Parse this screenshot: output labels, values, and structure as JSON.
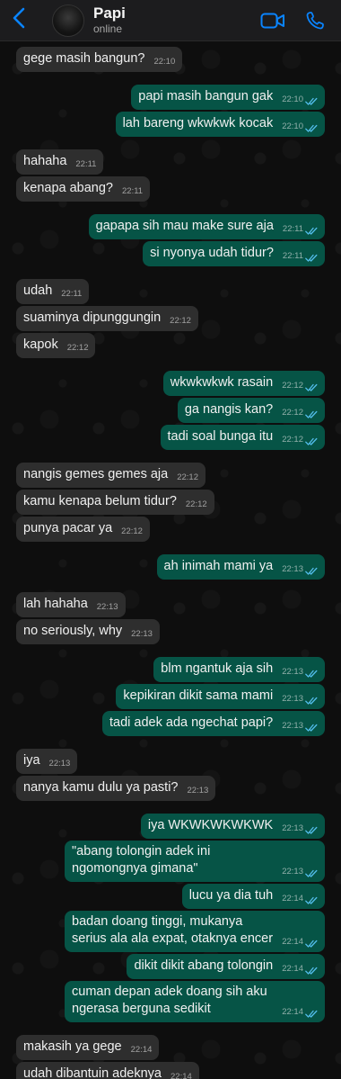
{
  "contact": {
    "name": "Papi",
    "status": "online"
  },
  "icons": {
    "back": "chevron-left-icon",
    "video": "video-camera-icon",
    "call": "phone-icon",
    "read": "double-check-icon"
  },
  "colors": {
    "incoming_bubble": "#2e2e2e",
    "outgoing_bubble": "#065446",
    "read_ticks": "#53bdeb",
    "accent": "#0a84ff"
  },
  "messages": [
    {
      "dir": "in",
      "text": "gege masih bangun?",
      "time": "22:10"
    },
    {
      "dir": "out",
      "text": "papi masih bangun gak",
      "time": "22:10"
    },
    {
      "dir": "out",
      "text": "lah bareng wkwkwk kocak",
      "time": "22:10"
    },
    {
      "dir": "in",
      "text": "hahaha",
      "time": "22:11"
    },
    {
      "dir": "in",
      "text": "kenapa abang?",
      "time": "22:11"
    },
    {
      "dir": "out",
      "text": "gapapa sih mau make sure aja",
      "time": "22:11"
    },
    {
      "dir": "out",
      "text": "si nyonya udah tidur?",
      "time": "22:11"
    },
    {
      "dir": "in",
      "text": "udah",
      "time": "22:11"
    },
    {
      "dir": "in",
      "text": "suaminya dipunggungin",
      "time": "22:12"
    },
    {
      "dir": "in",
      "text": "kapok",
      "time": "22:12"
    },
    {
      "dir": "out",
      "text": "wkwkwkwk rasain",
      "time": "22:12"
    },
    {
      "dir": "out",
      "text": "ga nangis kan?",
      "time": "22:12"
    },
    {
      "dir": "out",
      "text": "tadi soal bunga itu",
      "time": "22:12"
    },
    {
      "dir": "in",
      "text": "nangis gemes gemes aja",
      "time": "22:12"
    },
    {
      "dir": "in",
      "text": "kamu kenapa belum tidur?",
      "time": "22:12"
    },
    {
      "dir": "in",
      "text": "punya pacar ya",
      "time": "22:12"
    },
    {
      "dir": "out",
      "text": "ah inimah mami ya",
      "time": "22:13"
    },
    {
      "dir": "in",
      "text": "lah hahaha",
      "time": "22:13"
    },
    {
      "dir": "in",
      "text": "no seriously, why",
      "time": "22:13"
    },
    {
      "dir": "out",
      "text": "blm ngantuk aja sih",
      "time": "22:13"
    },
    {
      "dir": "out",
      "text": "kepikiran dikit sama mami",
      "time": "22:13"
    },
    {
      "dir": "out",
      "text": "tadi adek ada ngechat papi?",
      "time": "22:13"
    },
    {
      "dir": "in",
      "text": "iya",
      "time": "22:13"
    },
    {
      "dir": "in",
      "text": "nanya kamu dulu ya pasti?",
      "time": "22:13"
    },
    {
      "dir": "out",
      "text": "iya WKWKWKWKWK",
      "time": "22:13"
    },
    {
      "dir": "out",
      "text": "\"abang tolongin adek ini ngomongnya gimana\"",
      "time": "22:13"
    },
    {
      "dir": "out",
      "text": "lucu ya dia tuh",
      "time": "22:14"
    },
    {
      "dir": "out",
      "text": "badan doang tinggi, mukanya serius ala ala expat, otaknya encer",
      "time": "22:14"
    },
    {
      "dir": "out",
      "text": "dikit dikit abang tolongin",
      "time": "22:14"
    },
    {
      "dir": "out",
      "text": "cuman depan adek doang sih aku ngerasa berguna sedikit",
      "time": "22:14"
    },
    {
      "dir": "in",
      "text": "makasih ya gege",
      "time": "22:14"
    },
    {
      "dir": "in",
      "text": "udah dibantuin adeknya",
      "time": "22:14"
    }
  ]
}
